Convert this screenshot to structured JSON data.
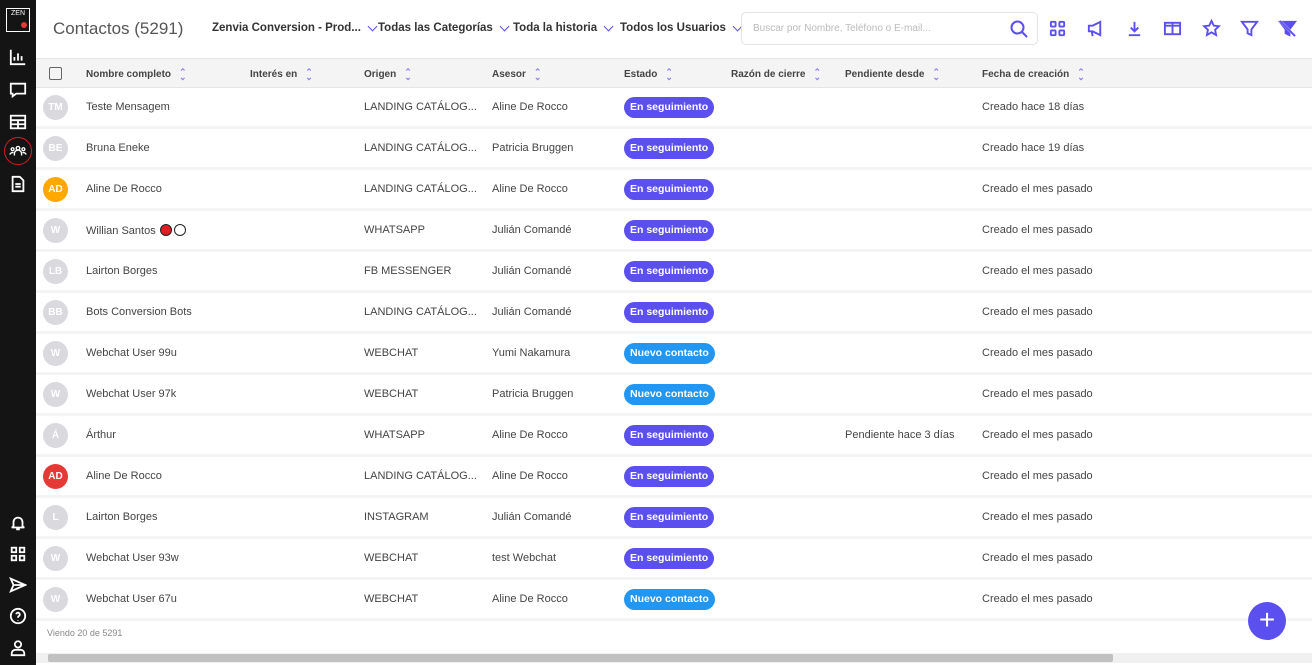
{
  "header": {
    "title": "Contactos (5291)",
    "filters": [
      "Zenvia Conversion - Prod...",
      "Todas las Categorías",
      "Toda la historia",
      "Todos los Usuarios"
    ],
    "search_placeholder": "Buscar por Nombre, Teléfono o E-mail..."
  },
  "toolbar_icons": [
    "grid-icon",
    "megaphone-icon",
    "download-icon",
    "columns-icon",
    "star-icon",
    "filter-icon",
    "clear-filter-icon"
  ],
  "sidebar": {
    "logo": "ZEN",
    "items": [
      "chart-icon",
      "chat-icon",
      "table-icon",
      "contacts-icon",
      "document-icon"
    ],
    "bottom": [
      "bell-icon",
      "apps-icon",
      "send-icon",
      "help-icon",
      "user-icon"
    ]
  },
  "columns": [
    "Nombre completo",
    "Interés en",
    "Origen",
    "Asesor",
    "Estado",
    "Razón de cierre",
    "Pendiente desde",
    "Fecha de creación"
  ],
  "colors": {
    "accent": "#5b4ff0",
    "following": "#5b4ff0",
    "new": "#2196f3"
  },
  "rows": [
    {
      "initials": "TM",
      "avatar": "#d9d9de",
      "name": "Teste Mensagem",
      "origin": "LANDING CATÁLOG...",
      "advisor": "Aline De Rocco",
      "status": "En seguimiento",
      "pending": "",
      "created": "Creado hace 18 días"
    },
    {
      "initials": "BE",
      "avatar": "#d9d9de",
      "name": "Bruna Eneke",
      "origin": "LANDING CATÁLOG...",
      "advisor": "Patricia Bruggen",
      "status": "En seguimiento",
      "pending": "",
      "created": "Creado hace 19 días"
    },
    {
      "initials": "AD",
      "avatar": "#ffa800",
      "name": "Aline De Rocco",
      "origin": "LANDING CATÁLOG...",
      "advisor": "Aline De Rocco",
      "status": "En seguimiento",
      "pending": "",
      "created": "Creado el mes pasado"
    },
    {
      "initials": "W",
      "avatar": "#d9d9de",
      "name": "Willian Santos",
      "dots": true,
      "origin": "WHATSAPP",
      "advisor": "Julián Comandé",
      "status": "En seguimiento",
      "pending": "",
      "created": "Creado el mes pasado"
    },
    {
      "initials": "LB",
      "avatar": "#d9d9de",
      "name": "Lairton Borges",
      "origin": "FB MESSENGER",
      "advisor": "Julián Comandé",
      "status": "En seguimiento",
      "pending": "",
      "created": "Creado el mes pasado"
    },
    {
      "initials": "BB",
      "avatar": "#d9d9de",
      "name": "Bots Conversion Bots",
      "origin": "LANDING CATÁLOG...",
      "advisor": "Julián Comandé",
      "status": "En seguimiento",
      "pending": "",
      "created": "Creado el mes pasado"
    },
    {
      "initials": "W",
      "avatar": "#d9d9de",
      "name": "Webchat User 99u",
      "origin": "WEBCHAT",
      "advisor": "Yumi Nakamura",
      "status": "Nuevo contacto",
      "pending": "",
      "created": "Creado el mes pasado"
    },
    {
      "initials": "W",
      "avatar": "#d9d9de",
      "name": "Webchat User 97k",
      "origin": "WEBCHAT",
      "advisor": "Patricia Bruggen",
      "status": "Nuevo contacto",
      "pending": "",
      "created": "Creado el mes pasado"
    },
    {
      "initials": "Á",
      "avatar": "#d9d9de",
      "name": "Árthur",
      "origin": "WHATSAPP",
      "advisor": "Aline De Rocco",
      "status": "En seguimiento",
      "pending": "Pendiente hace 3 días",
      "created": "Creado el mes pasado"
    },
    {
      "initials": "AD",
      "avatar": "#e53935",
      "name": "Aline De Rocco",
      "origin": "LANDING CATÁLOG...",
      "advisor": "Aline De Rocco",
      "status": "En seguimiento",
      "pending": "",
      "created": "Creado el mes pasado"
    },
    {
      "initials": "L",
      "avatar": "#d9d9de",
      "name": "Lairton Borges",
      "origin": "INSTAGRAM",
      "advisor": "Julián Comandé",
      "status": "En seguimiento",
      "pending": "",
      "created": "Creado el mes pasado"
    },
    {
      "initials": "W",
      "avatar": "#d9d9de",
      "name": "Webchat User 93w",
      "origin": "WEBCHAT",
      "advisor": "test Webchat",
      "status": "En seguimiento",
      "pending": "",
      "created": "Creado el mes pasado"
    },
    {
      "initials": "W",
      "avatar": "#d9d9de",
      "name": "Webchat User 67u",
      "origin": "WEBCHAT",
      "advisor": "Aline De Rocco",
      "status": "Nuevo contacto",
      "pending": "",
      "created": "Creado el mes pasado"
    }
  ],
  "footer": "Viendo 20 de 5291",
  "fab": "+"
}
